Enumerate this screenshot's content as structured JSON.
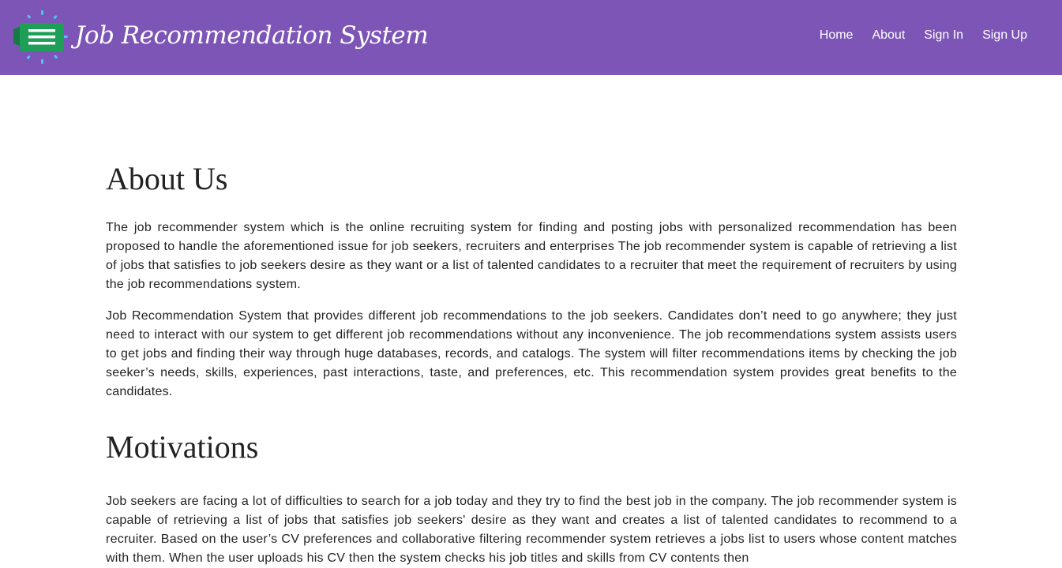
{
  "header": {
    "brand_title": "Job Recommendation System",
    "logo_icon": "menu-lines-icon",
    "nav": [
      {
        "label": "Home"
      },
      {
        "label": "About"
      },
      {
        "label": "Sign In"
      },
      {
        "label": "Sign Up"
      }
    ],
    "colors": {
      "navbar_bg": "#7d55b7",
      "logo_green": "#1f9e58",
      "logo_sparks": "#4fc3f7"
    }
  },
  "main": {
    "about": {
      "title": "About Us",
      "paragraphs": [
        "The job recommender system which is the online recruiting system for finding and posting jobs with personalized recommendation has been proposed to handle the aforementioned issue for job seekers, recruiters and enterprises The job recommender system is capable of retrieving a list of jobs that satisfies to job seekers desire as they want or a list of talented candidates to a recruiter that meet the requirement of recruiters by using the job recommendations system.",
        "Job Recommendation System that provides different job recommendations to the job seekers. Candidates don’t need to go anywhere; they just need to interact with our system to get different job recommendations without any inconvenience. The job recommendations system assists users to get jobs and finding their way through huge databases, records, and catalogs. The system will filter recommendations items by checking the job seeker’s needs, skills, experiences, past interactions, taste, and preferences, etc. This recommendation system provides great benefits to the candidates."
      ]
    },
    "motivations": {
      "title": "Motivations",
      "paragraphs": [
        "Job seekers are facing a lot of difficulties to search for a job today and they try to find the best job in the company. The job recommender system is capable of retrieving a list of jobs that satisfies job seekers' desire as they want and creates a list of talented candidates to recommend to a recruiter. Based on the user’s CV preferences and collaborative filtering recommender system retrieves a jobs list to users whose content matches with them. When the user uploads his CV then the system checks his job titles and skills from CV contents then"
      ]
    }
  }
}
